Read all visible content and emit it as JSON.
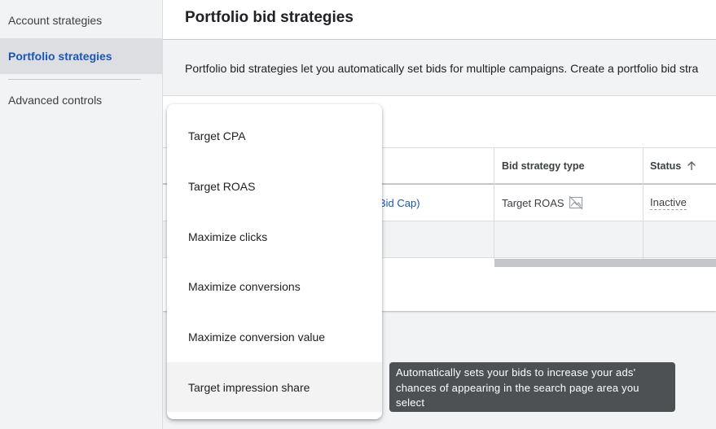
{
  "sidebar": {
    "items": [
      {
        "label": "Account strategies",
        "active": false
      },
      {
        "label": "Portfolio strategies",
        "active": true
      },
      {
        "label": "Advanced controls",
        "active": false
      }
    ]
  },
  "header": {
    "title": "Portfolio bid strategies"
  },
  "info": {
    "text": "Portfolio bid strategies let you automatically set bids for multiple campaigns. Create a portfolio bid stra"
  },
  "table": {
    "columns": [
      {
        "label": ""
      },
      {
        "label": "Bid strategy type"
      },
      {
        "label": "Status"
      }
    ],
    "rows": [
      {
        "name": "Bid Cap)",
        "type": "Target ROAS",
        "status": "Inactive"
      }
    ]
  },
  "menu": {
    "items": [
      {
        "label": "Target CPA"
      },
      {
        "label": "Target ROAS"
      },
      {
        "label": "Maximize clicks"
      },
      {
        "label": "Maximize conversions"
      },
      {
        "label": "Maximize conversion value"
      },
      {
        "label": "Target impression share"
      }
    ]
  },
  "tooltip": {
    "text": "Automatically sets your bids to increase your ads' chances of appearing in the search page area you select"
  },
  "icons": {
    "sort": "arrow-up-icon",
    "type_status": "no-image-icon"
  },
  "colors": {
    "accent": "#1a56b8",
    "sidebar_bg": "#f1f3f4",
    "tooltip_bg": "#4d5154"
  }
}
